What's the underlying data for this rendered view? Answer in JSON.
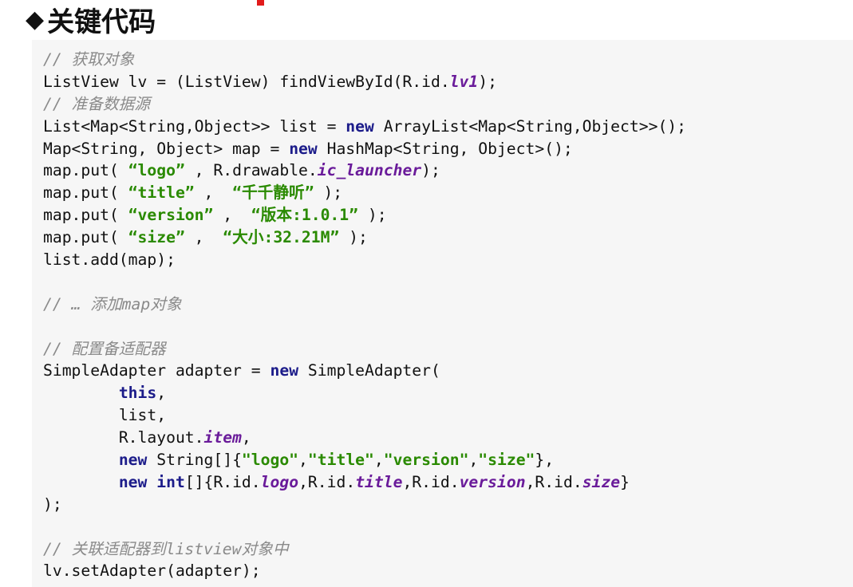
{
  "heading": {
    "bullet": "◆",
    "title": "关键代码"
  },
  "code_lines": [
    [
      {
        "t": "// 获取对象",
        "c": "cm"
      }
    ],
    [
      {
        "t": "ListView lv = (ListView) findViewById(R.id."
      },
      {
        "t": "lv1",
        "c": "fld"
      },
      {
        "t": ");"
      }
    ],
    [
      {
        "t": "// 准备数据源",
        "c": "cm"
      }
    ],
    [
      {
        "t": "List<Map<String,Object>> list = "
      },
      {
        "t": "new",
        "c": "kw"
      },
      {
        "t": " ArrayList<Map<String,Object>>();"
      }
    ],
    [
      {
        "t": "Map<String, Object> map = "
      },
      {
        "t": "new",
        "c": "kw"
      },
      {
        "t": " HashMap<String, Object>();"
      }
    ],
    [
      {
        "t": "map.put( "
      },
      {
        "t": "“logo”",
        "c": "str"
      },
      {
        "t": " , R.drawable."
      },
      {
        "t": "ic_launcher",
        "c": "fld"
      },
      {
        "t": ");"
      }
    ],
    [
      {
        "t": "map.put( "
      },
      {
        "t": "“title”",
        "c": "str"
      },
      {
        "t": " ,  "
      },
      {
        "t": "“千千静听”",
        "c": "str"
      },
      {
        "t": " );"
      }
    ],
    [
      {
        "t": "map.put( "
      },
      {
        "t": "“version”",
        "c": "str"
      },
      {
        "t": " ,  "
      },
      {
        "t": "“版本:1.0.1”",
        "c": "str"
      },
      {
        "t": " );"
      }
    ],
    [
      {
        "t": "map.put( "
      },
      {
        "t": "“size”",
        "c": "str"
      },
      {
        "t": " ,  "
      },
      {
        "t": "“大小:32.21M”",
        "c": "str"
      },
      {
        "t": " );"
      }
    ],
    [
      {
        "t": "list.add(map);"
      }
    ],
    [],
    [
      {
        "t": "// … 添加map对象",
        "c": "cm"
      }
    ],
    [],
    [
      {
        "t": "// 配置备适配器",
        "c": "cm"
      }
    ],
    [
      {
        "t": "SimpleAdapter adapter = "
      },
      {
        "t": "new",
        "c": "kw"
      },
      {
        "t": " SimpleAdapter("
      }
    ],
    [
      {
        "t": "        "
      },
      {
        "t": "this",
        "c": "kw"
      },
      {
        "t": ","
      }
    ],
    [
      {
        "t": "        list,"
      }
    ],
    [
      {
        "t": "        R.layout."
      },
      {
        "t": "item",
        "c": "fld"
      },
      {
        "t": ","
      }
    ],
    [
      {
        "t": "        "
      },
      {
        "t": "new",
        "c": "kw"
      },
      {
        "t": " String[]{"
      },
      {
        "t": "\"logo\"",
        "c": "str"
      },
      {
        "t": ","
      },
      {
        "t": "\"title\"",
        "c": "str"
      },
      {
        "t": ","
      },
      {
        "t": "\"version\"",
        "c": "str"
      },
      {
        "t": ","
      },
      {
        "t": "\"size\"",
        "c": "str"
      },
      {
        "t": "},"
      }
    ],
    [
      {
        "t": "        "
      },
      {
        "t": "new",
        "c": "kw"
      },
      {
        "t": " "
      },
      {
        "t": "int",
        "c": "kw"
      },
      {
        "t": "[]{R.id."
      },
      {
        "t": "logo",
        "c": "fld"
      },
      {
        "t": ",R.id."
      },
      {
        "t": "title",
        "c": "fld"
      },
      {
        "t": ",R.id."
      },
      {
        "t": "version",
        "c": "fld"
      },
      {
        "t": ",R.id."
      },
      {
        "t": "size",
        "c": "fld"
      },
      {
        "t": "}"
      }
    ],
    [
      {
        "t": ");"
      }
    ],
    [],
    [
      {
        "t": "// 关联适配器到listview对象中",
        "c": "cm"
      }
    ],
    [
      {
        "t": "lv.setAdapter(adapter);"
      }
    ]
  ]
}
